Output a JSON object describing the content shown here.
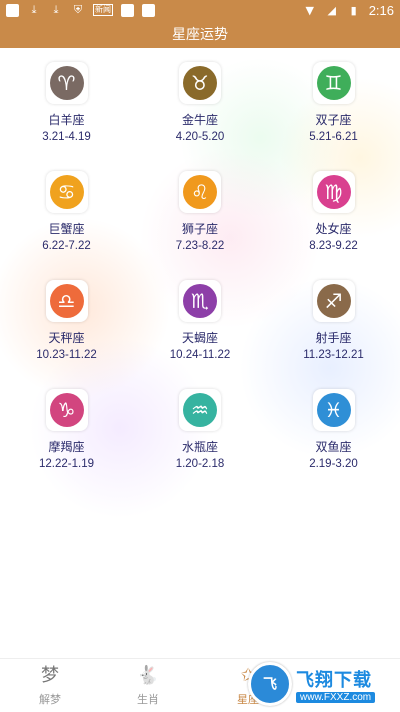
{
  "status_bar": {
    "time": "2:16",
    "left_icons": [
      "app-icon",
      "download-icon",
      "download-icon",
      "shield-icon",
      "app-badge-icon",
      "app-icon",
      "app-icon"
    ],
    "badge_text": "新闻",
    "right_icons": [
      "wifi-icon",
      "signal-icon",
      "battery-icon"
    ]
  },
  "title": "星座运势",
  "signs": [
    {
      "name": "白羊座",
      "dates": "3.21-4.19",
      "glyph": "♈",
      "color": "#7a6a63"
    },
    {
      "name": "金牛座",
      "dates": "4.20-5.20",
      "glyph": "♉",
      "color": "#8a6a2a"
    },
    {
      "name": "双子座",
      "dates": "5.21-6.21",
      "glyph": "♊",
      "color": "#3fae5a"
    },
    {
      "name": "巨蟹座",
      "dates": "6.22-7.22",
      "glyph": "♋",
      "color": "#f0a21e"
    },
    {
      "name": "狮子座",
      "dates": "7.23-8.22",
      "glyph": "♌",
      "color": "#f0991d"
    },
    {
      "name": "处女座",
      "dates": "8.23-9.22",
      "glyph": "♍",
      "color": "#d9408f"
    },
    {
      "name": "天秤座",
      "dates": "10.23-11.22",
      "glyph": "♎",
      "color": "#ee6b3b"
    },
    {
      "name": "天蝎座",
      "dates": "10.24-11.22",
      "glyph": "♏",
      "color": "#8d3fa8"
    },
    {
      "name": "射手座",
      "dates": "11.23-12.21",
      "glyph": "♐",
      "color": "#8a6a4a"
    },
    {
      "name": "摩羯座",
      "dates": "12.22-1.19",
      "glyph": "♑",
      "color": "#d2457f"
    },
    {
      "name": "水瓶座",
      "dates": "1.20-2.18",
      "glyph": "♒",
      "color": "#36b3a0"
    },
    {
      "name": "双鱼座",
      "dates": "2.19-3.20",
      "glyph": "♓",
      "color": "#2f8fd6"
    }
  ],
  "tabs": [
    {
      "label": "解梦",
      "icon": "梦",
      "icon_name": "dream-icon",
      "active": false
    },
    {
      "label": "生肖",
      "icon": "🐇",
      "icon_name": "rabbit-icon",
      "active": false
    },
    {
      "label": "星座",
      "icon": "✩",
      "icon_name": "star-icon",
      "active": true
    }
  ],
  "watermark": {
    "logo_text": "飞",
    "title": "飞翔下载",
    "url": "www.FXXZ.com"
  },
  "colors": {
    "accent": "#c98a49",
    "text": "#2b2b6b"
  }
}
